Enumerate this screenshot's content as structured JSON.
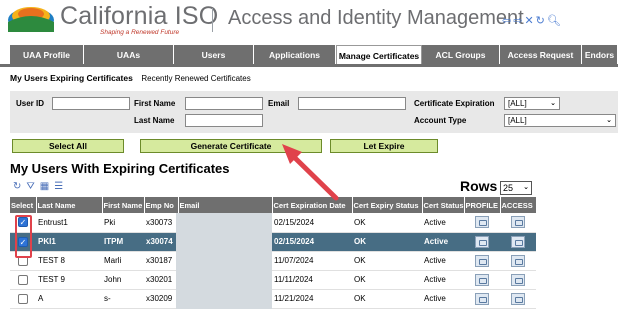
{
  "brand": {
    "name": "California ISO",
    "tagline": "Shaping a Renewed Future"
  },
  "app_title": "Access and Identity Management",
  "header_icons": [
    "back-arrow-icon",
    "forward-arrow-icon",
    "close-icon",
    "refresh-icon",
    "search-icon"
  ],
  "tabs": [
    {
      "label": "UAA Profile",
      "active": false
    },
    {
      "label": "UAAs",
      "active": false
    },
    {
      "label": "Users",
      "active": false
    },
    {
      "label": "Applications",
      "active": false
    },
    {
      "label": "Manage Certificates",
      "active": true
    },
    {
      "label": "ACL Groups",
      "active": false
    },
    {
      "label": "Access Request",
      "active": false
    },
    {
      "label": "Endors",
      "active": false
    }
  ],
  "subtabs": {
    "active": "My Users Expiring Certificates",
    "other": "Recently Renewed Certificates"
  },
  "filters": {
    "user_id": "User ID",
    "first_name": "First Name",
    "last_name": "Last Name",
    "email": "Email",
    "cert_expiration": "Certificate Expiration",
    "cert_expiration_value": "[ALL]",
    "account_type": "Account Type",
    "account_type_value": "[ALL]"
  },
  "buttons": {
    "select_all": "Select All",
    "generate": "Generate Certificate",
    "let_expire": "Let Expire"
  },
  "grid": {
    "title": "My Users With Expiring Certificates",
    "rows_label": "Rows",
    "rows_value": "25",
    "columns": [
      "Select",
      "Last Name",
      "First Name",
      "Emp No",
      "Email",
      "Cert Expiration Date",
      "Cert Expiry Status",
      "Cert Status",
      "PROFILE",
      "ACCESS"
    ],
    "rows": [
      {
        "checked": true,
        "selected": false,
        "last": "Entrust1",
        "first": "Pki",
        "emp": "x30073",
        "exp": "02/15/2024",
        "expiry_status": "OK",
        "status": "Active"
      },
      {
        "checked": true,
        "selected": true,
        "last": "PKI1",
        "first": "ITPM",
        "emp": "x30074",
        "exp": "02/15/2024",
        "expiry_status": "OK",
        "status": "Active"
      },
      {
        "checked": false,
        "selected": false,
        "last": "TEST 8",
        "first": "Marli",
        "emp": "x30187",
        "exp": "11/07/2024",
        "expiry_status": "OK",
        "status": "Active"
      },
      {
        "checked": false,
        "selected": false,
        "last": "TEST 9",
        "first": "John",
        "emp": "x30201",
        "exp": "11/11/2024",
        "expiry_status": "OK",
        "status": "Active"
      },
      {
        "checked": false,
        "selected": false,
        "last": "A",
        "first": "s-",
        "emp": "x30209",
        "exp": "11/21/2024",
        "expiry_status": "OK",
        "status": "Active"
      }
    ]
  },
  "colors": {
    "tab_bg": "#6f6f6f",
    "selected_row": "#476d84",
    "button_green": "#d6ea9e",
    "annotation_red": "#e0424b"
  }
}
